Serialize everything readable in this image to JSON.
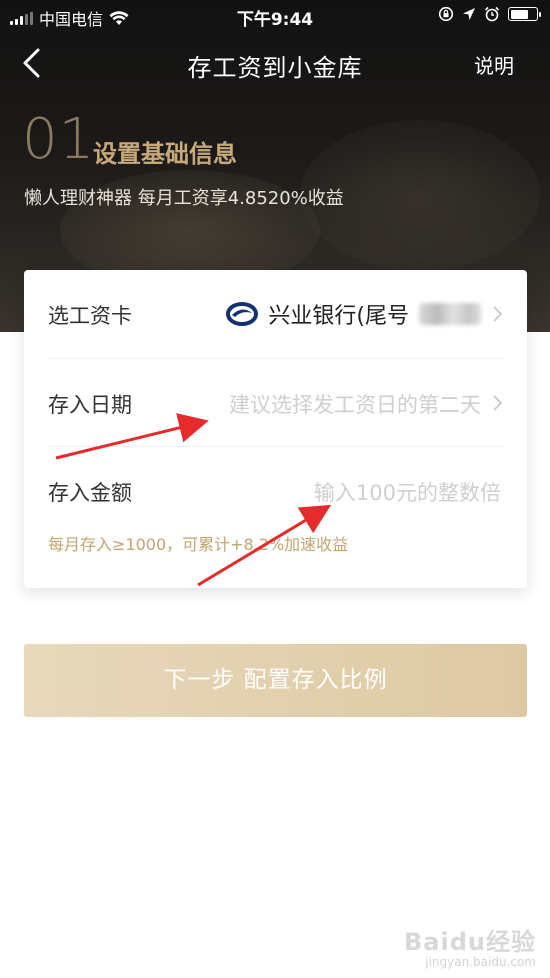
{
  "status_bar": {
    "carrier": "中国电信",
    "time": "下午9:44"
  },
  "nav": {
    "title": "存工资到小金库",
    "help": "说明"
  },
  "step": {
    "number": "01",
    "title": "设置基础信息",
    "subtitle": "懒人理财神器 每月工资享4.8520%收益"
  },
  "form": {
    "card_row": {
      "label": "选工资卡",
      "value": "兴业银行(尾号"
    },
    "date_row": {
      "label": "存入日期",
      "placeholder": "建议选择发工资日的第二天"
    },
    "amount_row": {
      "label": "存入金额",
      "placeholder": "输入100元的整数倍"
    },
    "hint": "每月存入≥1000，可累计+8.2%加速收益"
  },
  "next_button": {
    "label": "下一步 配置存入比例"
  },
  "watermark": {
    "main": "Baidu经验",
    "sub": "jingyan.baidu.com"
  },
  "colors": {
    "accent_gold": "#c8a979",
    "button": "#e2d0ae",
    "annotation_arrow": "#e52b2b"
  },
  "icons": [
    "signal-icon",
    "wifi-icon",
    "rotation-lock-icon",
    "location-icon",
    "alarm-icon",
    "battery-icon",
    "back-icon",
    "bank-logo-icon",
    "chevron-right-icon"
  ]
}
